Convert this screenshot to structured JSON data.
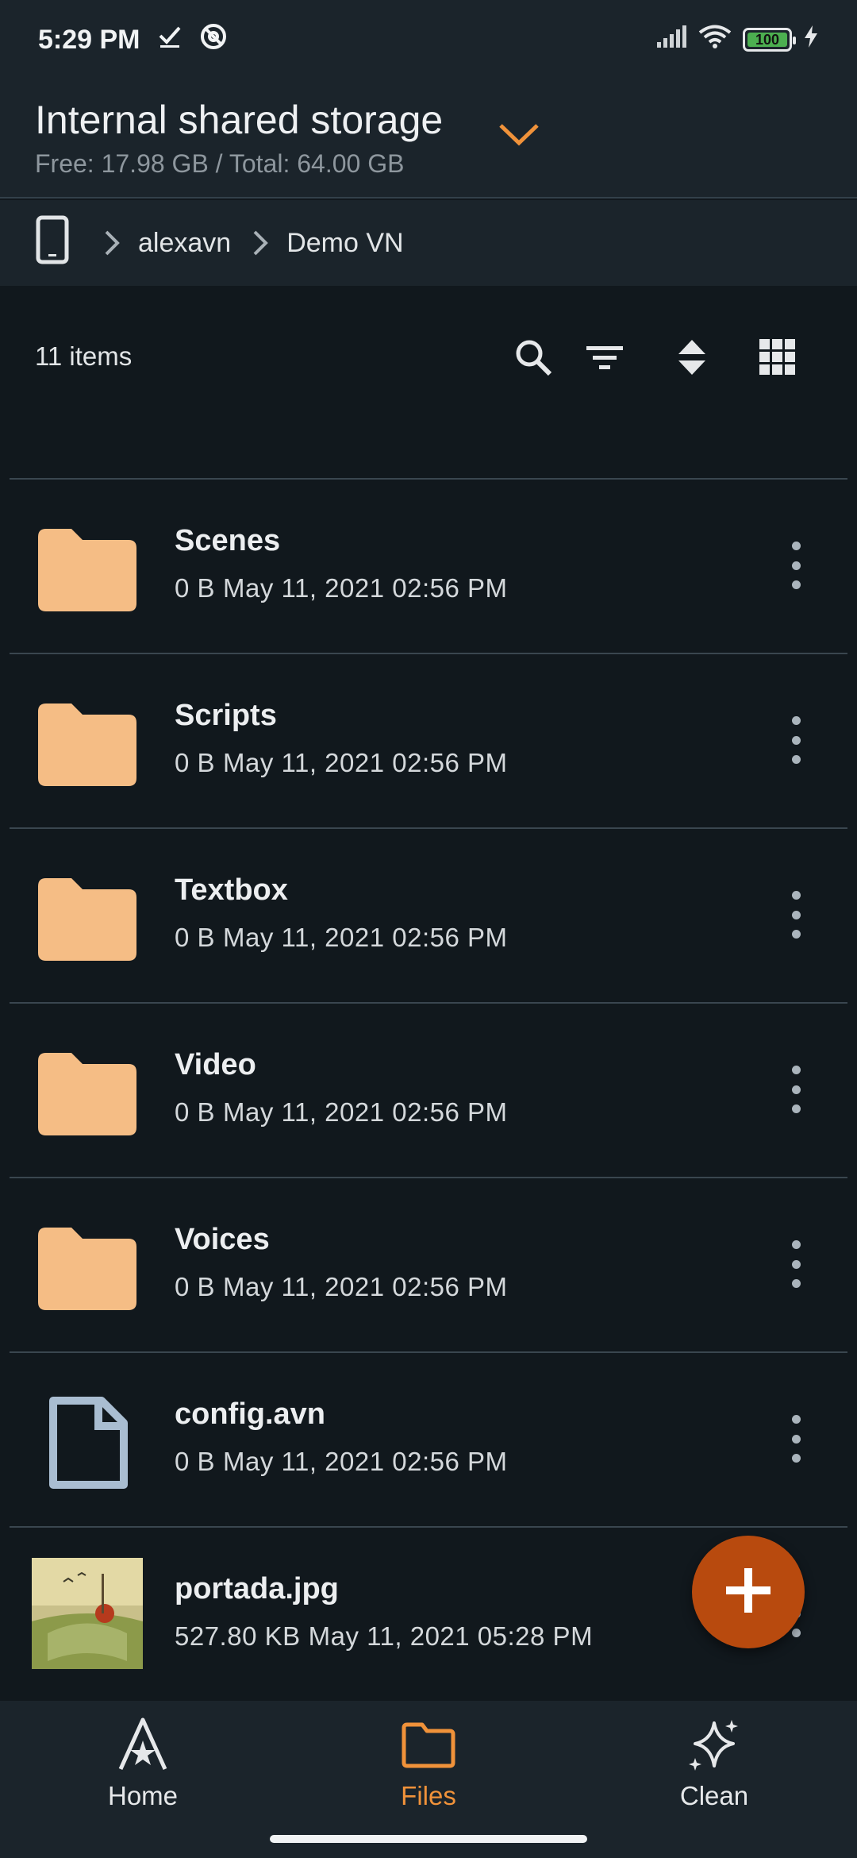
{
  "status_bar": {
    "time": "5:29 PM",
    "battery": "100"
  },
  "header": {
    "title": "Internal shared storage",
    "subtitle": "Free: 17.98 GB / Total: 64.00 GB"
  },
  "breadcrumb": {
    "items": [
      "alexavn",
      "Demo VN"
    ]
  },
  "toolbar": {
    "count": "11 items"
  },
  "files": [
    {
      "name": "Scenes",
      "size": "0 B",
      "date": "May 11, 2021 02:56 PM",
      "type": "folder"
    },
    {
      "name": "Scripts",
      "size": "0 B",
      "date": "May 11, 2021 02:56 PM",
      "type": "folder"
    },
    {
      "name": "Textbox",
      "size": "0 B",
      "date": "May 11, 2021 02:56 PM",
      "type": "folder"
    },
    {
      "name": "Video",
      "size": "0 B",
      "date": "May 11, 2021 02:56 PM",
      "type": "folder"
    },
    {
      "name": "Voices",
      "size": "0 B",
      "date": "May 11, 2021 02:56 PM",
      "type": "folder"
    },
    {
      "name": "config.avn",
      "size": "0 B",
      "date": "May 11, 2021 02:56 PM",
      "type": "file"
    },
    {
      "name": "portada.jpg",
      "size": "527.80 KB",
      "date": "May 11, 2021 05:28 PM",
      "type": "image"
    }
  ],
  "bottom_nav": {
    "items": [
      {
        "label": "Home",
        "icon": "home-a-icon",
        "active": false
      },
      {
        "label": "Files",
        "icon": "folder-icon",
        "active": true
      },
      {
        "label": "Clean",
        "icon": "sparkle-icon",
        "active": false
      }
    ]
  },
  "colors": {
    "accent": "#f0923a",
    "folder": "#f5bd85",
    "fab": "#b84a0e",
    "background": "#11181d",
    "surface": "#1b242b"
  }
}
